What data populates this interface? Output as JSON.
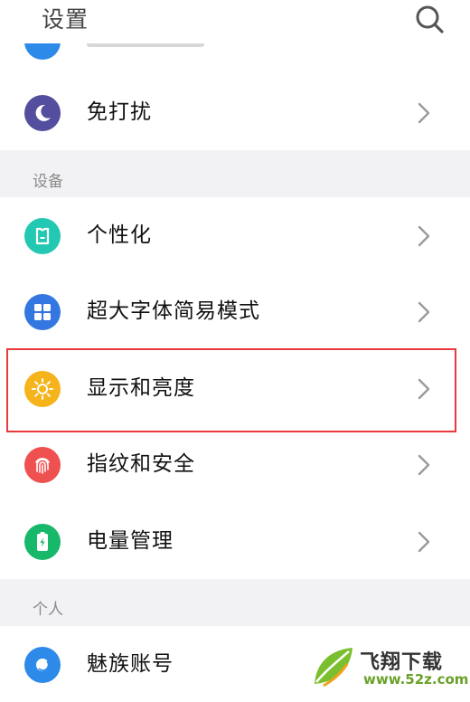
{
  "header": {
    "title": "设置"
  },
  "groups": {
    "top": {
      "dnd_label": "免打扰"
    },
    "device": {
      "section_label": "设备",
      "items": [
        {
          "label": "个性化"
        },
        {
          "label": "超大字体简易模式"
        },
        {
          "label": "显示和亮度"
        },
        {
          "label": "指纹和安全"
        },
        {
          "label": "电量管理"
        }
      ]
    },
    "personal": {
      "section_label": "个人",
      "items": [
        {
          "label": "魅族账号"
        }
      ]
    }
  },
  "colors": {
    "dnd": "#534f9e",
    "personalize": "#22c8b1",
    "font_mode": "#3477e0",
    "display": "#f5b31c",
    "fingerprint": "#ef5050",
    "battery": "#17b86a",
    "account": "#2d8ae8",
    "highlight": "#e8393c"
  },
  "icons": {
    "header": "search-icon",
    "dnd": "moon-icon",
    "personalize": "tshirt-icon",
    "font_mode": "grid-icon",
    "display": "sun-icon",
    "fingerprint": "fingerprint-icon",
    "battery": "battery-icon",
    "account": "account-icon",
    "row": "chevron-right-icon"
  },
  "watermark": {
    "title": "飞翔下载",
    "url": "www.52z.com"
  }
}
